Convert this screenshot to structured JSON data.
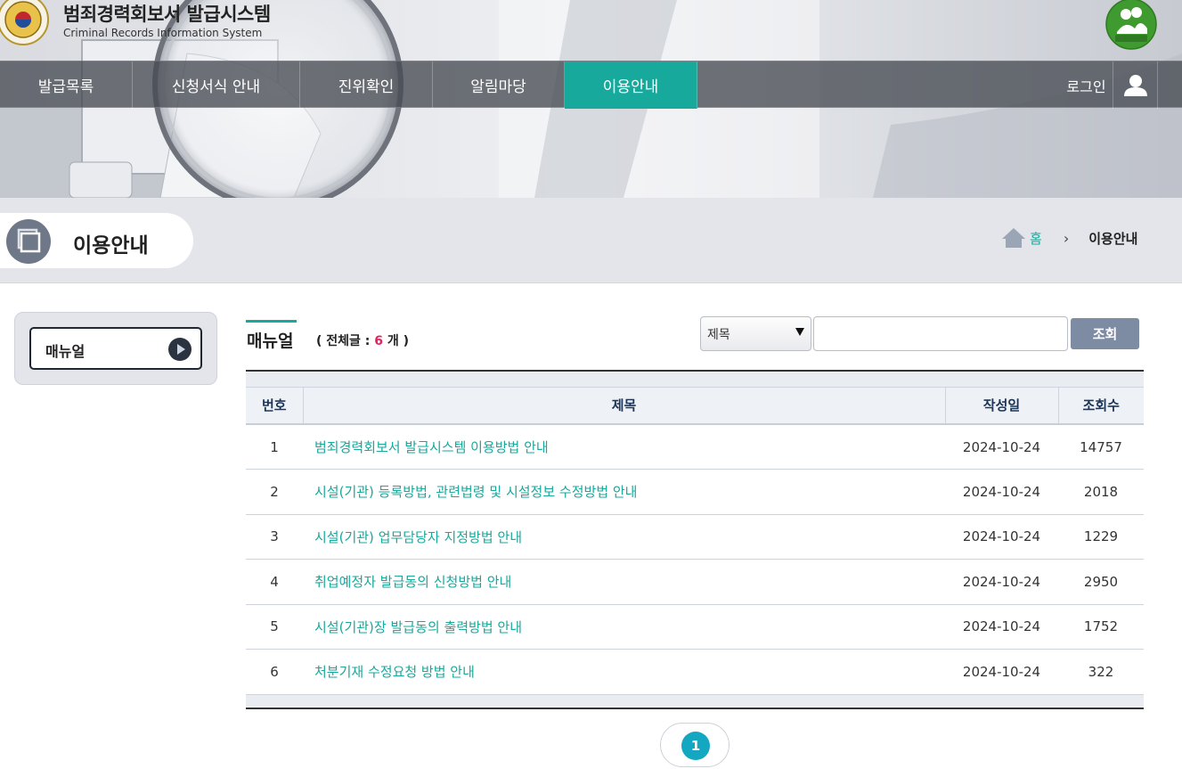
{
  "header": {
    "title": "범죄경력회보서 발급시스템",
    "subtitle": "Criminal Records Information System"
  },
  "nav": {
    "items": [
      {
        "label": "발급목록"
      },
      {
        "label": "신청서식 안내"
      },
      {
        "label": "진위확인"
      },
      {
        "label": "알림마당"
      },
      {
        "label": "이용안내",
        "active": true
      }
    ],
    "login_label": "로그인"
  },
  "page": {
    "title": "이용안내",
    "breadcrumb": {
      "home": "홈",
      "current": "이용안내"
    }
  },
  "sidebar": {
    "items": [
      {
        "label": "매뉴얼"
      }
    ]
  },
  "board": {
    "title": "매뉴얼",
    "count_prefix": "( 전체글 : ",
    "count": "6",
    "count_suffix": " 개 )",
    "search": {
      "field_selected": "제목",
      "button_label": "조회",
      "input_value": ""
    },
    "columns": [
      "번호",
      "제목",
      "작성일",
      "조회수"
    ],
    "rows": [
      {
        "no": "1",
        "subject": "범죄경력회보서 발급시스템 이용방법 안내",
        "date": "2024-10-24",
        "views": "14757"
      },
      {
        "no": "2",
        "subject": "시설(기관) 등록방법, 관련법령 및 시설정보 수정방법 안내",
        "date": "2024-10-24",
        "views": "2018"
      },
      {
        "no": "3",
        "subject": "시설(기관) 업무담당자 지정방법 안내",
        "date": "2024-10-24",
        "views": "1229"
      },
      {
        "no": "4",
        "subject": "취업예정자 발급동의 신청방법 안내",
        "date": "2024-10-24",
        "views": "2950"
      },
      {
        "no": "5",
        "subject": "시설(기관)장 발급동의 출력방법 안내",
        "date": "2024-10-24",
        "views": "1752"
      },
      {
        "no": "6",
        "subject": "처분기재 수정요청 방법 안내",
        "date": "2024-10-24",
        "views": "322"
      }
    ]
  },
  "pagination": {
    "current": "1"
  },
  "colors": {
    "accent": "#17a99c",
    "count_highlight": "#e0245e",
    "pager": "#14a7c2",
    "search_button": "#7d8ba3"
  },
  "icons": [
    "police-emblem-icon",
    "eprivacy-badge-icon",
    "user-icon",
    "window-icon",
    "home-icon",
    "chevron-right-icon",
    "arrow-right-circle-icon"
  ]
}
